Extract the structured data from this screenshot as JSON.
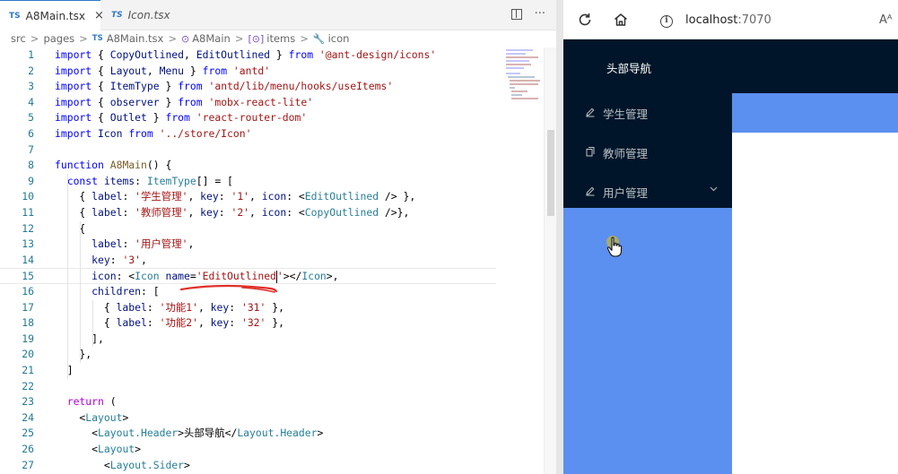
{
  "editor": {
    "tabs": [
      {
        "label": "A8Main.tsx",
        "badge": "TS",
        "close": "×"
      },
      {
        "label": "Icon.tsx",
        "badge": "TS"
      }
    ],
    "actions": {
      "more": "···"
    },
    "breadcrumb": [
      {
        "label": "src"
      },
      {
        "label": "pages"
      },
      {
        "badge": "TS",
        "label": "A8Main.tsx"
      },
      {
        "symbol": "⊙",
        "label": "A8Main"
      },
      {
        "symbol": "[⊙]",
        "label": "items"
      },
      {
        "symbol": "🔧",
        "label": "icon"
      }
    ],
    "separator": ">",
    "lines": [
      {
        "n": "1",
        "tokens": [
          [
            "kw",
            "import"
          ],
          [
            "txt",
            " { "
          ],
          [
            "id",
            "CopyOutlined"
          ],
          [
            "txt",
            ", "
          ],
          [
            "id",
            "EditOutlined"
          ],
          [
            "txt",
            " } "
          ],
          [
            "kw",
            "from"
          ],
          [
            "txt",
            " "
          ],
          [
            "str",
            "'@ant-design/icons'"
          ]
        ]
      },
      {
        "n": "2",
        "tokens": [
          [
            "kw",
            "import"
          ],
          [
            "txt",
            " { "
          ],
          [
            "id",
            "Layout"
          ],
          [
            "txt",
            ", "
          ],
          [
            "id",
            "Menu"
          ],
          [
            "txt",
            " } "
          ],
          [
            "kw",
            "from"
          ],
          [
            "txt",
            " "
          ],
          [
            "str",
            "'antd'"
          ]
        ]
      },
      {
        "n": "3",
        "tokens": [
          [
            "kw",
            "import"
          ],
          [
            "txt",
            " { "
          ],
          [
            "id",
            "ItemType"
          ],
          [
            "txt",
            " } "
          ],
          [
            "kw",
            "from"
          ],
          [
            "txt",
            " "
          ],
          [
            "str",
            "'antd/lib/menu/hooks/useItems'"
          ]
        ]
      },
      {
        "n": "4",
        "tokens": [
          [
            "kw",
            "import"
          ],
          [
            "txt",
            " { "
          ],
          [
            "id",
            "observer"
          ],
          [
            "txt",
            " } "
          ],
          [
            "kw",
            "from"
          ],
          [
            "txt",
            " "
          ],
          [
            "str",
            "'mobx-react-lite'"
          ]
        ]
      },
      {
        "n": "5",
        "tokens": [
          [
            "kw",
            "import"
          ],
          [
            "txt",
            " { "
          ],
          [
            "id",
            "Outlet"
          ],
          [
            "txt",
            " } "
          ],
          [
            "kw",
            "from"
          ],
          [
            "txt",
            " "
          ],
          [
            "str",
            "'react-router-dom'"
          ]
        ]
      },
      {
        "n": "6",
        "tokens": [
          [
            "kw",
            "import"
          ],
          [
            "txt",
            " "
          ],
          [
            "id",
            "Icon"
          ],
          [
            "txt",
            " "
          ],
          [
            "kw",
            "from"
          ],
          [
            "txt",
            " "
          ],
          [
            "str",
            "'../store/Icon'"
          ]
        ]
      },
      {
        "n": "7",
        "tokens": []
      },
      {
        "n": "8",
        "tokens": [
          [
            "kw",
            "function"
          ],
          [
            "txt",
            " "
          ],
          [
            "fn",
            "A8Main"
          ],
          [
            "txt",
            "() {"
          ]
        ]
      },
      {
        "n": "9",
        "tokens": [
          [
            "txt",
            "  "
          ],
          [
            "kw",
            "const"
          ],
          [
            "txt",
            " "
          ],
          [
            "id",
            "items"
          ],
          [
            "txt",
            ": "
          ],
          [
            "ty",
            "ItemType"
          ],
          [
            "txt",
            "[] = ["
          ]
        ]
      },
      {
        "n": "10",
        "tokens": [
          [
            "txt",
            "    { "
          ],
          [
            "id",
            "label"
          ],
          [
            "txt",
            ": "
          ],
          [
            "str",
            "'学生管理'"
          ],
          [
            "txt",
            ", "
          ],
          [
            "id",
            "key"
          ],
          [
            "txt",
            ": "
          ],
          [
            "str",
            "'1'"
          ],
          [
            "txt",
            ", "
          ],
          [
            "id",
            "icon"
          ],
          [
            "txt",
            ": <"
          ],
          [
            "ty",
            "EditOutlined"
          ],
          [
            "txt",
            " /> },"
          ]
        ]
      },
      {
        "n": "11",
        "tokens": [
          [
            "txt",
            "    { "
          ],
          [
            "id",
            "label"
          ],
          [
            "txt",
            ": "
          ],
          [
            "str",
            "'教师管理'"
          ],
          [
            "txt",
            ", "
          ],
          [
            "id",
            "key"
          ],
          [
            "txt",
            ": "
          ],
          [
            "str",
            "'2'"
          ],
          [
            "txt",
            ", "
          ],
          [
            "id",
            "icon"
          ],
          [
            "txt",
            ": <"
          ],
          [
            "ty",
            "CopyOutlined"
          ],
          [
            "txt",
            " />},"
          ]
        ]
      },
      {
        "n": "12",
        "tokens": [
          [
            "txt",
            "    {"
          ]
        ]
      },
      {
        "n": "13",
        "tokens": [
          [
            "txt",
            "      "
          ],
          [
            "id",
            "label"
          ],
          [
            "txt",
            ": "
          ],
          [
            "str",
            "'用户管理'"
          ],
          [
            "txt",
            ","
          ]
        ]
      },
      {
        "n": "14",
        "tokens": [
          [
            "txt",
            "      "
          ],
          [
            "id",
            "key"
          ],
          [
            "txt",
            ": "
          ],
          [
            "str",
            "'3'"
          ],
          [
            "txt",
            ","
          ]
        ]
      },
      {
        "n": "15",
        "tokens": [
          [
            "txt",
            "      "
          ],
          [
            "id",
            "icon"
          ],
          [
            "txt",
            ": <"
          ],
          [
            "ty",
            "Icon"
          ],
          [
            "txt",
            " "
          ],
          [
            "id",
            "name"
          ],
          [
            "txt",
            "="
          ],
          [
            "str",
            "'EditOutlined"
          ],
          [
            "cursor",
            ""
          ],
          [
            "str",
            "'"
          ],
          [
            "txt",
            "></"
          ],
          [
            "ty",
            "Icon"
          ],
          [
            "txt",
            ">,"
          ]
        ]
      },
      {
        "n": "16",
        "tokens": [
          [
            "txt",
            "      "
          ],
          [
            "id",
            "children"
          ],
          [
            "txt",
            ": ["
          ]
        ]
      },
      {
        "n": "17",
        "tokens": [
          [
            "txt",
            "        { "
          ],
          [
            "id",
            "label"
          ],
          [
            "txt",
            ": "
          ],
          [
            "str",
            "'功能1'"
          ],
          [
            "txt",
            ", "
          ],
          [
            "id",
            "key"
          ],
          [
            "txt",
            ": "
          ],
          [
            "str",
            "'31'"
          ],
          [
            "txt",
            " },"
          ]
        ]
      },
      {
        "n": "18",
        "tokens": [
          [
            "txt",
            "        { "
          ],
          [
            "id",
            "label"
          ],
          [
            "txt",
            ": "
          ],
          [
            "str",
            "'功能2'"
          ],
          [
            "txt",
            ", "
          ],
          [
            "id",
            "key"
          ],
          [
            "txt",
            ": "
          ],
          [
            "str",
            "'32'"
          ],
          [
            "txt",
            " },"
          ]
        ]
      },
      {
        "n": "19",
        "tokens": [
          [
            "txt",
            "      ],"
          ]
        ]
      },
      {
        "n": "20",
        "tokens": [
          [
            "txt",
            "    },"
          ]
        ]
      },
      {
        "n": "21",
        "tokens": [
          [
            "txt",
            "  ]"
          ]
        ]
      },
      {
        "n": "22",
        "tokens": []
      },
      {
        "n": "23",
        "tokens": [
          [
            "txt",
            "  "
          ],
          [
            "ctl",
            "return"
          ],
          [
            "txt",
            " ("
          ]
        ]
      },
      {
        "n": "24",
        "tokens": [
          [
            "txt",
            "    <"
          ],
          [
            "ty",
            "Layout"
          ],
          [
            "txt",
            ">"
          ]
        ]
      },
      {
        "n": "25",
        "tokens": [
          [
            "txt",
            "      <"
          ],
          [
            "ty",
            "Layout.Header"
          ],
          [
            "txt",
            ">头部导航</"
          ],
          [
            "ty",
            "Layout.Header"
          ],
          [
            "txt",
            ">"
          ]
        ]
      },
      {
        "n": "26",
        "tokens": [
          [
            "txt",
            "      <"
          ],
          [
            "ty",
            "Layout"
          ],
          [
            "txt",
            ">"
          ]
        ]
      },
      {
        "n": "27",
        "tokens": [
          [
            "txt",
            "        <"
          ],
          [
            "ty",
            "Layout.Sider"
          ],
          [
            "txt",
            ">"
          ]
        ]
      }
    ],
    "current_line": "15"
  },
  "browser": {
    "url_host": "localhost",
    "url_port": ":7070",
    "read_aloud": "Aᴬ"
  },
  "app": {
    "header_title": "头部导航",
    "menu": [
      {
        "label": "学生管理",
        "icon": "edit-icon"
      },
      {
        "label": "教师管理",
        "icon": "copy-icon"
      },
      {
        "label": "用户管理",
        "icon": "edit-icon",
        "has_children": true
      }
    ],
    "colors": {
      "header_bg": "#001529",
      "content_blue": "#5b8ff0",
      "annotation_red": "#e0312b"
    }
  }
}
